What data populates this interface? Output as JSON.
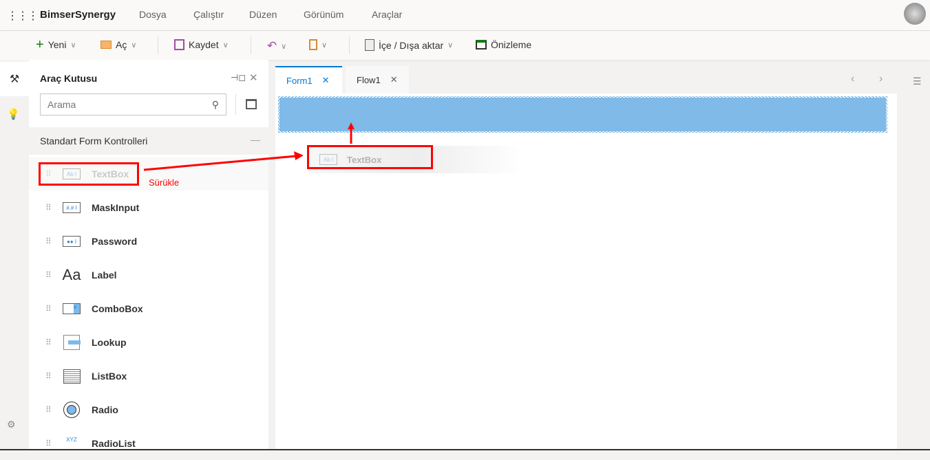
{
  "app": {
    "title": "BimserSynergy",
    "menu": [
      "Dosya",
      "Çalıştır",
      "Düzen",
      "Görünüm",
      "Araçlar"
    ]
  },
  "toolbar": {
    "new": "Yeni",
    "open": "Aç",
    "save": "Kaydet",
    "import_export": "İçe / Dışa aktar",
    "preview": "Önizleme"
  },
  "toolbox": {
    "title": "Araç Kutusu",
    "search_placeholder": "Arama",
    "section": "Standart Form Kontrolleri",
    "items": [
      "TextBox",
      "MaskInput",
      "Password",
      "Label",
      "ComboBox",
      "Lookup",
      "ListBox",
      "Radio",
      "RadioList"
    ]
  },
  "tabs": [
    "Form1",
    "Flow1"
  ],
  "annotation": {
    "drag_label": "Sürükle",
    "ghost_label": "TextBox"
  },
  "colors": {
    "accent": "#0078d4",
    "drop_zone": "#7fbae8",
    "annotation": "#ff0000"
  }
}
